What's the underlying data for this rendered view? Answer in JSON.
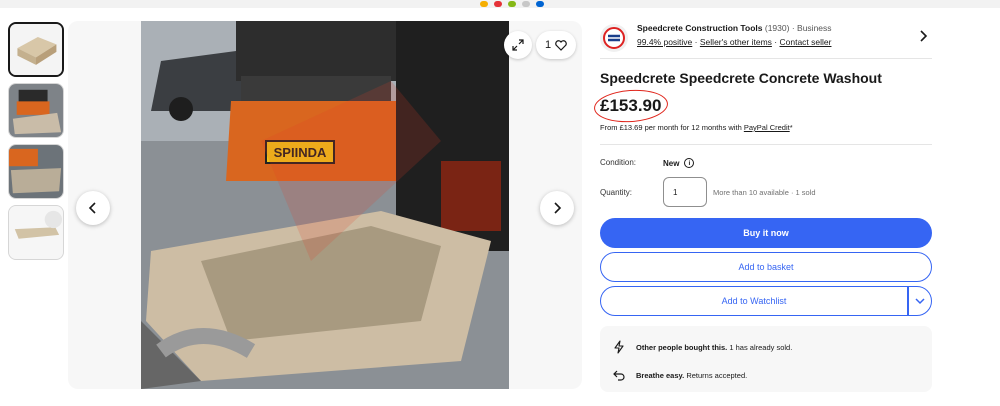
{
  "seller": {
    "name": "Speedcrete Construction Tools",
    "feedback_count": "(1930)",
    "separator": "·",
    "type": "Business",
    "positive": "99.4% positive",
    "other_items": "Seller's other items",
    "contact": "Contact seller"
  },
  "listing": {
    "title": "Speedcrete Speedcrete Concrete Washout",
    "price": "£153.90",
    "finance_text": "From £13.69 per month for 12 months with",
    "finance_link": "PayPal Credit",
    "finance_suffix": "*",
    "condition_label": "Condition:",
    "condition_value": "New",
    "quantity_label": "Quantity:",
    "quantity_value": "1",
    "availability": "More than 10 available · 1 sold"
  },
  "gallery": {
    "watch_count": "1",
    "photo_plate_text": "SPIINDA",
    "thumb_count": 4,
    "selected_thumb_index": 1
  },
  "actions": {
    "buy_now": "Buy it now",
    "add_to_basket": "Add to basket",
    "add_to_watchlist": "Add to Watchlist"
  },
  "info": {
    "popular_bold": "Other people bought this.",
    "popular_rest": "1 has already sold.",
    "returns_bold": "Breathe easy.",
    "returns_rest": "Returns accepted."
  },
  "colors": {
    "primary_blue": "#3665f3",
    "price_circle": "#e0261c",
    "text": "#191919",
    "muted": "#707070"
  },
  "icons": [
    "expand-icon",
    "heart-icon",
    "chevron-left-icon",
    "chevron-right-icon",
    "chevron-down-icon",
    "info-icon",
    "lightning-icon",
    "return-arrow-icon",
    "seller-logo-icon"
  ]
}
